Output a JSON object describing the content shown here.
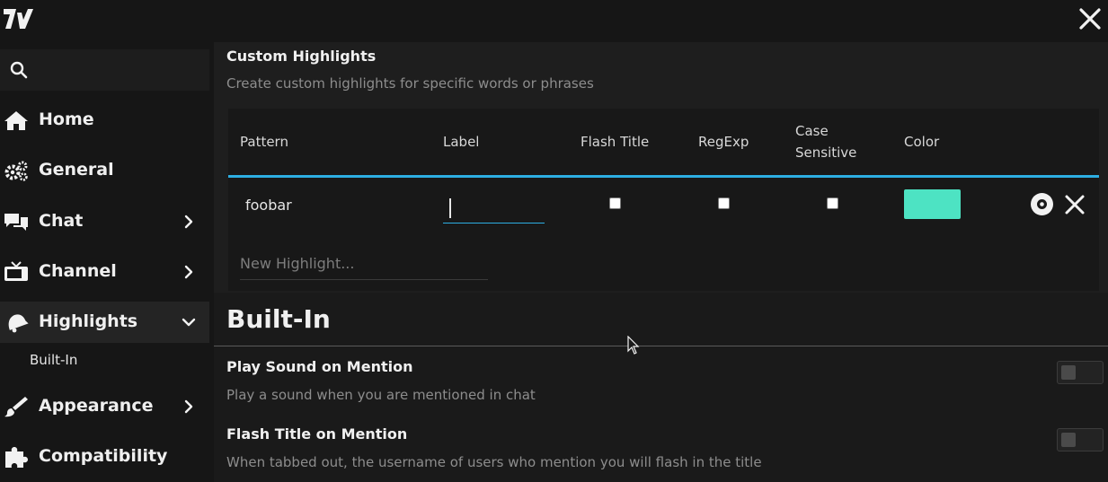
{
  "colors": {
    "accent": "#2daee2",
    "highlight_color": "#4de3c3"
  },
  "header": {
    "logo_icon": "7tv-logo-icon",
    "close_icon": "close-icon"
  },
  "sidebar": {
    "search_icon": "search-icon",
    "items": [
      {
        "label": "Home",
        "icon": "home-icon"
      },
      {
        "label": "General",
        "icon": "gears-icon"
      },
      {
        "label": "Chat",
        "icon": "chat-icon"
      },
      {
        "label": "Channel",
        "icon": "tv-icon"
      },
      {
        "label": "Highlights",
        "icon": "bell-icon"
      },
      {
        "label": "Appearance",
        "icon": "brush-icon"
      },
      {
        "label": "Compatibility",
        "icon": "puzzle-icon"
      }
    ],
    "sub_items": [
      {
        "label": "Built-In"
      }
    ]
  },
  "custom": {
    "title": "Custom Highlights",
    "description": "Create custom highlights for specific words or phrases",
    "columns": {
      "pattern": "Pattern",
      "label": "Label",
      "flash": "Flash Title",
      "regexp": "RegExp",
      "case": "Case Sensitive",
      "color": "Color"
    },
    "rows": [
      {
        "pattern": "foobar",
        "label": "",
        "flash": false,
        "regexp": false,
        "case": false,
        "color": "#4de3c3"
      }
    ],
    "new_placeholder": "New Highlight..."
  },
  "builtin": {
    "title": "Built-In",
    "options": [
      {
        "title": "Play Sound on Mention",
        "description": "Play a sound when you are mentioned in chat",
        "enabled": false
      },
      {
        "title": "Flash Title on Mention",
        "description": "When tabbed out, the username of users who mention you will flash in the title",
        "enabled": false
      }
    ]
  }
}
